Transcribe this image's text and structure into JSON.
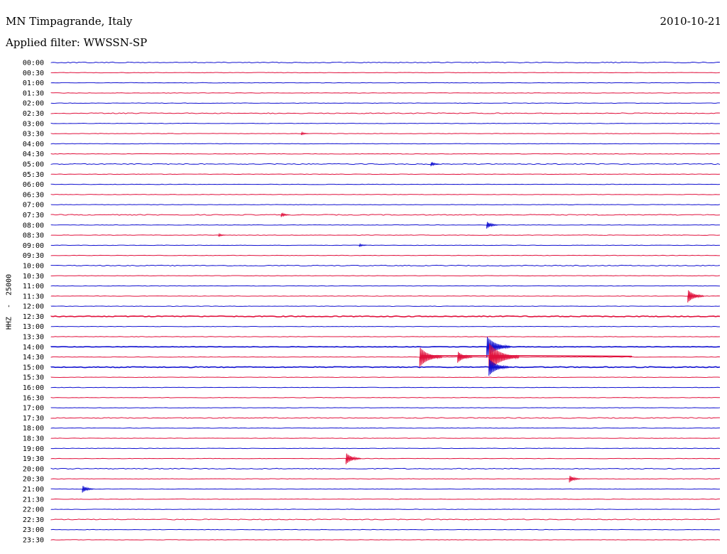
{
  "header": {
    "station": "MN Timpagrande, Italy",
    "date": "2010-10-21",
    "filter": "Applied filter: WWSSN-SP",
    "channel_label": "HHZ  -  25000"
  },
  "colors": {
    "even": "#1010d0",
    "odd": "#e0103c"
  },
  "chart_data": {
    "type": "helicorder",
    "title": "MN Timpagrande, Italy",
    "date": "2010-10-21",
    "filter": "WWSSN-SP",
    "ylabel": "HHZ  -  25000",
    "row_labels": [
      "00:00",
      "00:30",
      "01:00",
      "01:30",
      "02:00",
      "02:30",
      "03:00",
      "03:30",
      "04:00",
      "04:30",
      "05:00",
      "05:30",
      "06:00",
      "06:30",
      "07:00",
      "07:30",
      "08:00",
      "08:30",
      "09:00",
      "09:30",
      "10:00",
      "10:30",
      "11:00",
      "11:30",
      "12:00",
      "12:30",
      "13:00",
      "13:30",
      "14:00",
      "14:30",
      "15:00",
      "15:30",
      "16:00",
      "16:30",
      "17:00",
      "17:30",
      "18:00",
      "18:30",
      "19:00",
      "19:30",
      "20:00",
      "20:30",
      "21:00",
      "21:30",
      "22:00",
      "22:30",
      "23:00",
      "23:30"
    ],
    "row_minutes": 30,
    "events": [
      {
        "row": "05:00",
        "minute": 17.0,
        "amplitude": 3
      },
      {
        "row": "03:30",
        "minute": 11.2,
        "amplitude": 2
      },
      {
        "row": "07:30",
        "minute": 10.3,
        "amplitude": 3
      },
      {
        "row": "08:00",
        "minute": 19.5,
        "amplitude": 5
      },
      {
        "row": "08:30",
        "minute": 7.5,
        "amplitude": 2
      },
      {
        "row": "09:00",
        "minute": 13.8,
        "amplitude": 2
      },
      {
        "row": "11:30",
        "minute": 28.5,
        "amplitude": 9
      },
      {
        "row": "14:00",
        "minute": 19.5,
        "amplitude": 15
      },
      {
        "row": "14:30",
        "minute": 16.5,
        "amplitude": 14
      },
      {
        "row": "14:30",
        "minute": 18.2,
        "amplitude": 8
      },
      {
        "row": "14:30",
        "minute": 19.6,
        "amplitude": 20
      },
      {
        "row": "15:00",
        "minute": 19.6,
        "amplitude": 12
      },
      {
        "row": "19:30",
        "minute": 13.2,
        "amplitude": 8
      },
      {
        "row": "20:30",
        "minute": 23.2,
        "amplitude": 5
      },
      {
        "row": "21:00",
        "minute": 1.4,
        "amplitude": 5
      }
    ],
    "grid": false
  }
}
